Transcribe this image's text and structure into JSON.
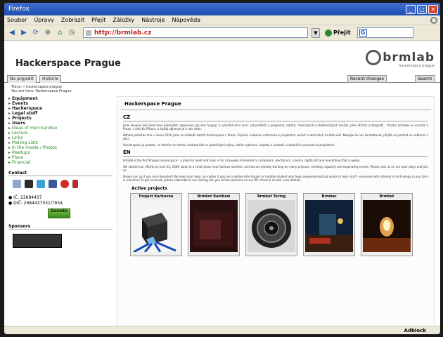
{
  "window": {
    "title": "Firefox"
  },
  "menu": [
    "Soubor",
    "Úpravy",
    "Zobrazit",
    "Přejít",
    "Záložky",
    "Nástroje",
    "Nápověda"
  ],
  "navbar": {
    "url": "http://brmlab.cz",
    "go_label": "Přejít",
    "search_engine": "G"
  },
  "site": {
    "title": "Hackerspace Prague",
    "logo_text": "brmlab",
    "logo_sub": "hackerspace prague"
  },
  "tabs": {
    "left": [
      "Na prg/edit",
      "Historie"
    ],
    "right": [
      "Recent changes",
      "Search"
    ]
  },
  "breadcrumbs": [
    "Trace: » hackerspace prague",
    "You are here: Hackerspace Prague"
  ],
  "sidebar": {
    "items": [
      {
        "label": "Equipment",
        "style": "b"
      },
      {
        "label": "Events",
        "style": "b"
      },
      {
        "label": "Hackerspace",
        "style": "b"
      },
      {
        "label": "Legal stuff",
        "style": "b"
      },
      {
        "label": "Projects",
        "style": "b"
      },
      {
        "label": "Users",
        "style": "b"
      },
      {
        "label": "Ideas of merchandise",
        "style": "g"
      },
      {
        "label": "Lecture",
        "style": "g"
      },
      {
        "label": "Links",
        "style": "g"
      },
      {
        "label": "Mailing Lists",
        "style": "g"
      },
      {
        "label": "In the media / Photos",
        "style": "g"
      },
      {
        "label": "Meetups",
        "style": "g"
      },
      {
        "label": "Place",
        "style": "g"
      },
      {
        "label": "Financial",
        "style": "g"
      }
    ],
    "contact_head": "Contact",
    "contacts": [
      "● IČ: 22684437",
      "● DIČ: 2684437551/7654"
    ],
    "donate": "Donate",
    "sponsors_head": "Sponsors"
  },
  "content": {
    "title": "Hackerspace Prague",
    "cz_head": "CZ",
    "cz_paras": [
      "Jsme skupina lidí, které baví přemýšlet, objevovat, jak věci fungují, a vytvářet věci nové - od počítačů a programů, robotů, chemických a elektronických hraček, přes 3D tisk a fotografii... Prostor brmlabu se nachází v Praze, v ulici Ku Pištoru, a každý zájemce je u nás vítán.",
      "Během jediného dne v únoru 2010 jsme se rozhodli založit hackerspace v Praze. Zájemci naleznou informace o projektech, akcích a aktivitách na této wiki. Nebojte se nás kontaktovat, přijďte se podívat na některou z akcí.",
      "Hackerspace je prostor, ve kterém se mohou scházet lidé se společnými zájmy, sdílet vybavení, nápady a znalosti, a společně pracovat na projektech."
    ],
    "en_head": "EN",
    "en_paras": [
      "brmlab is the first Prague hackerspace - a place to meet and hack in for all people interested in computers, electronics, science, digital art and everything that is geeky.",
      "We started our efforts on June 22, 2009, back at a small place near Karlovo náměstí, and we are already working on many projects, meeting regularly and organizing events. Please visit us on our open days and join us.",
      "Please join us if you are interested! We need your help, no matter if you are a skilled elite hacker or humble student who feels inexperienced but wants to learn stuff - everyone with interest in technology in any form is welcome! To get involved, please subscribe to our mailing list, you will be welcome on our IRC channel as well. (see details)"
    ],
    "projects_head": "Active projects",
    "projects": [
      "Project Karbovna",
      "Brmbot Rainbow",
      "Brmbot Turing",
      "Brmbar",
      "Brmbot"
    ]
  },
  "status": {
    "right": "Adblock"
  },
  "colors": {
    "accent": "#2a8a2a",
    "url": "#c21f1f",
    "titlebar": "#2f5fb8"
  }
}
